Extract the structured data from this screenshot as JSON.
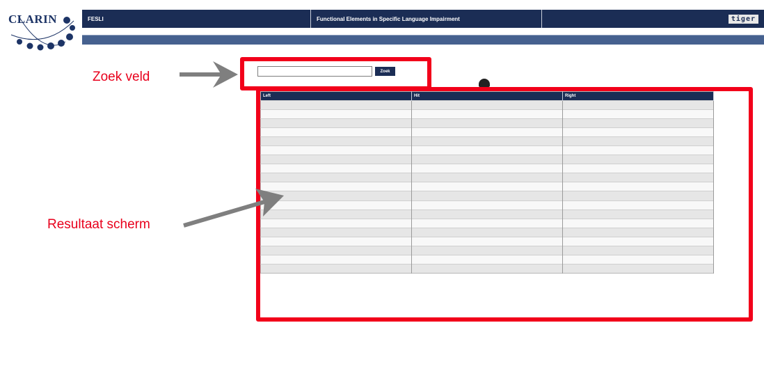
{
  "logo": {
    "text": "CLARIN"
  },
  "header": {
    "app_name": "FESLI",
    "app_title": "Functional Elements in Specific Language Impairment",
    "badge": "tiger"
  },
  "search": {
    "button_label": "Zoek",
    "value": ""
  },
  "results": {
    "columns": [
      "Left",
      "Hit",
      "Right"
    ],
    "row_count": 19
  },
  "annotations": {
    "search_label": "Zoek veld",
    "results_label": "Resultaat scherm"
  },
  "colors": {
    "header_navy": "#1b2d55",
    "subbar_blue": "#46618f",
    "annotation_red": "#f2001a",
    "arrow_grey": "#7f7f7f"
  }
}
